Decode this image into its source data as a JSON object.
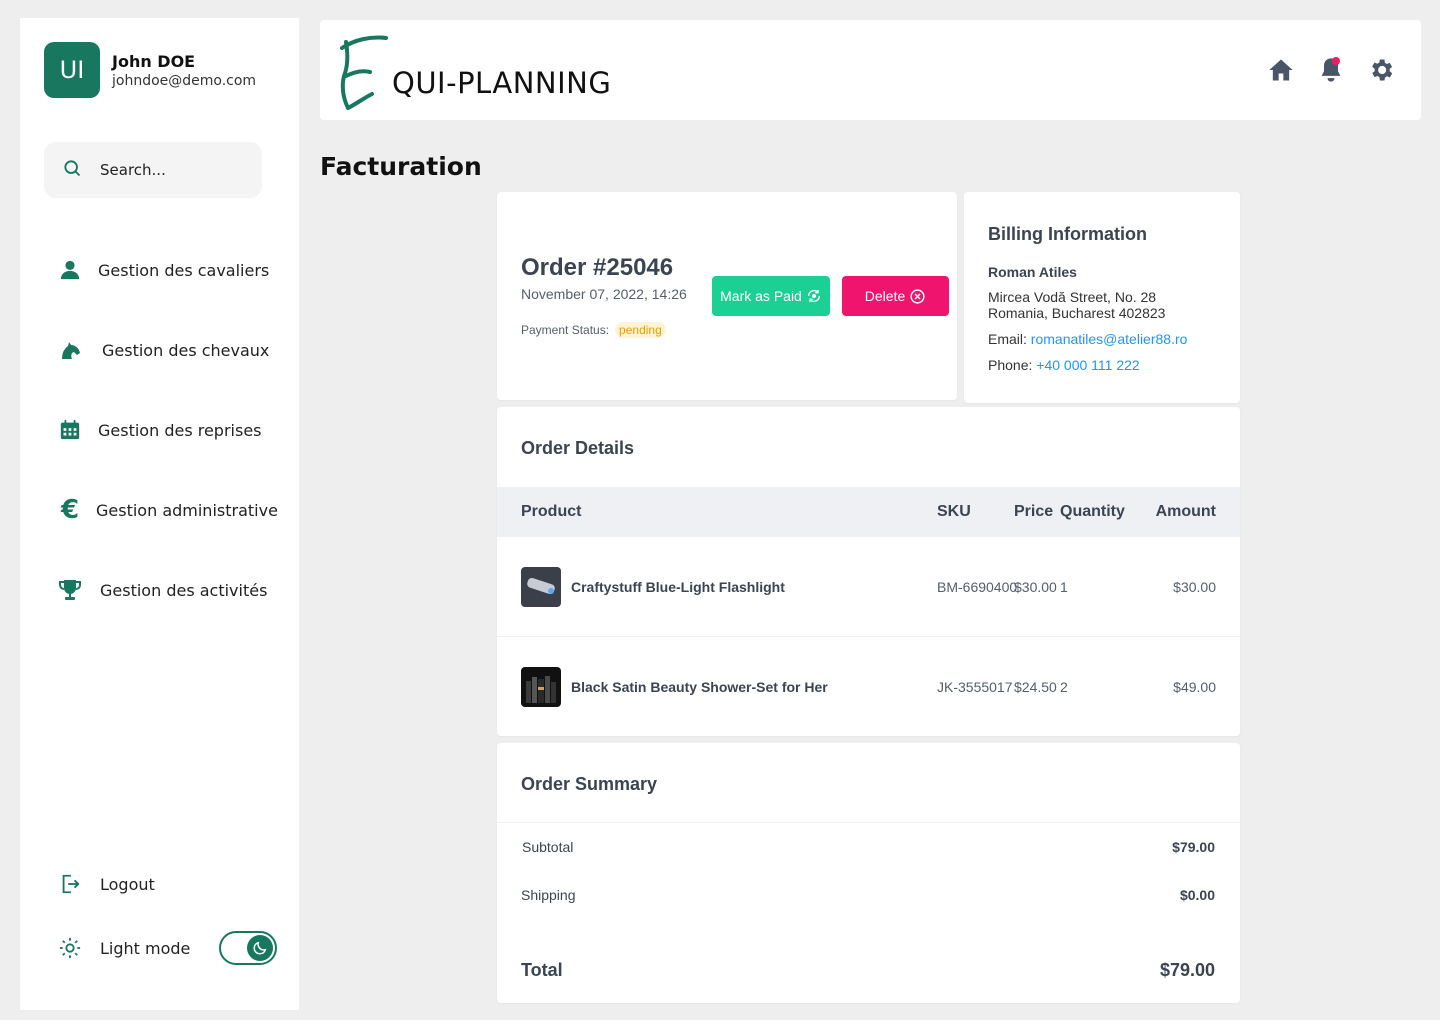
{
  "colors": {
    "brand": "#17775f",
    "paid": "#1ccf93",
    "delete": "#f0146e",
    "link": "#2196f3",
    "badge_text": "#e6a100"
  },
  "user": {
    "initials": "UI",
    "name": "John DOE",
    "email": "johndoe@demo.com"
  },
  "search": {
    "placeholder": "Search..."
  },
  "nav": {
    "items": [
      {
        "label": "Gestion des cavaliers",
        "icon": "user-icon"
      },
      {
        "label": "Gestion des chevaux",
        "icon": "horse-icon"
      },
      {
        "label": "Gestion des reprises",
        "icon": "calendar-icon"
      },
      {
        "label": "Gestion administrative",
        "icon": "euro-icon"
      },
      {
        "label": "Gestion des activités",
        "icon": "trophy-icon"
      }
    ],
    "logout": "Logout",
    "theme_label": "Light mode"
  },
  "header": {
    "logo_letter": "E",
    "logo_text": "QUI-PLANNING"
  },
  "page": {
    "title": "Facturation"
  },
  "order": {
    "title": "Order #25046",
    "date": "November 07, 2022, 14:26",
    "payment_status_label": "Payment Status:",
    "payment_status": "pending",
    "mark_paid_label": "Mark as Paid",
    "delete_label": "Delete"
  },
  "billing": {
    "title": "Billing Information",
    "name": "Roman Atiles",
    "address_line1": "Mircea Vodă Street, No. 28",
    "address_line2": "Romania, Bucharest 402823",
    "email_label": "Email:",
    "email": "romanatiles@atelier88.ro",
    "phone_label": "Phone:",
    "phone": "+40 000 111 222"
  },
  "order_details": {
    "title": "Order Details",
    "columns": {
      "product": "Product",
      "sku": "SKU",
      "price": "Price",
      "quantity": "Quantity",
      "amount": "Amount"
    },
    "rows": [
      {
        "product": "Craftystuff Blue-Light Flashlight",
        "sku": "BM-6690400",
        "price": "$30.00",
        "quantity": "1",
        "amount": "$30.00"
      },
      {
        "product": "Black Satin Beauty Shower-Set for Her",
        "sku": "JK-3555017",
        "price": "$24.50",
        "quantity": "2",
        "amount": "$49.00"
      }
    ]
  },
  "summary": {
    "title": "Order Summary",
    "subtotal_label": "Subtotal",
    "subtotal": "$79.00",
    "shipping_label": "Shipping",
    "shipping": "$0.00",
    "total_label": "Total",
    "total": "$79.00"
  }
}
